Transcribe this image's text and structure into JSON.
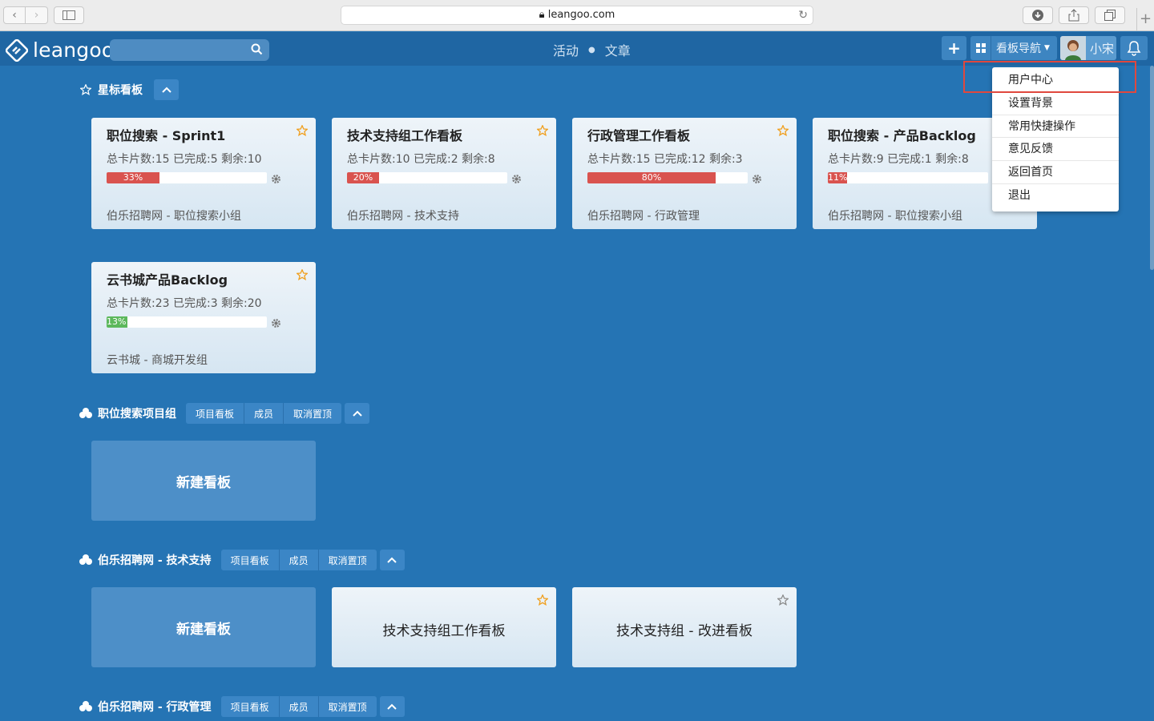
{
  "browser": {
    "url": "leangoo.com"
  },
  "topbar": {
    "logo": "leangoo",
    "links": [
      "活动",
      "文章"
    ],
    "boards_nav_label": "看板导航",
    "user_name": "小宋"
  },
  "user_menu": {
    "items": [
      "用户中心",
      "设置背景",
      "常用快捷操作",
      "意见反馈",
      "返回首页",
      "退出"
    ]
  },
  "starred": {
    "title": "星标看板",
    "boards": [
      {
        "title": "职位搜索 - Sprint1",
        "stats": "总卡片数:15  已完成:5  剩余:10",
        "progress_label": "33%",
        "progress": 33,
        "color": "#d9534f",
        "team": "伯乐招聘网 - 职位搜索小组"
      },
      {
        "title": "技术支持组工作看板",
        "stats": "总卡片数:10  已完成:2  剩余:8",
        "progress_label": "20%",
        "progress": 20,
        "color": "#d9534f",
        "team": "伯乐招聘网 - 技术支持"
      },
      {
        "title": "行政管理工作看板",
        "stats": "总卡片数:15  已完成:12  剩余:3",
        "progress_label": "80%",
        "progress": 80,
        "color": "#d9534f",
        "team": "伯乐招聘网 - 行政管理"
      },
      {
        "title": "职位搜索 - 产品Backlog",
        "stats": "总卡片数:9  已完成:1  剩余:8",
        "progress_label": "11%",
        "progress": 11,
        "color": "#d9534f",
        "team": "伯乐招聘网 - 职位搜索小组"
      },
      {
        "title": "云书城产品Backlog",
        "stats": "总卡片数:23  已完成:3  剩余:20",
        "progress_label": "13%",
        "progress": 13,
        "color": "#5cb85c",
        "team": "云书城 - 商城开发组"
      }
    ]
  },
  "section_buttons": [
    "项目看板",
    "成员",
    "取消置顶"
  ],
  "groups": [
    {
      "title": "职位搜索项目组",
      "new_board": "新建看板",
      "boards": []
    },
    {
      "title": "伯乐招聘网 - 技术支持",
      "new_board": "新建看板",
      "boards": [
        "技术支持组工作看板",
        "技术支持组 - 改进看板"
      ]
    },
    {
      "title": "伯乐招聘网 - 行政管理"
    }
  ]
}
